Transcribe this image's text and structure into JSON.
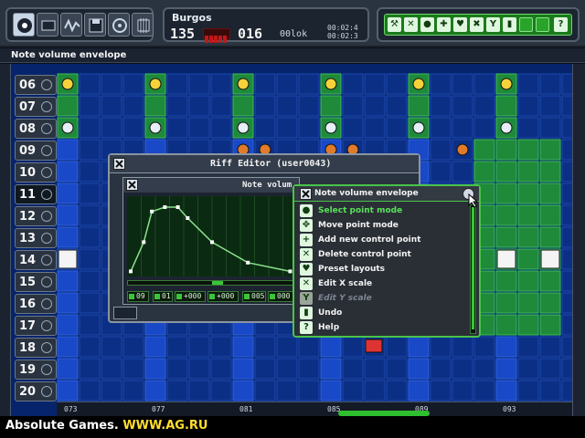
{
  "status_bar": {
    "text": "Note volume envelope"
  },
  "song_info": {
    "name": "Burgos",
    "pattern": "135",
    "row": "016",
    "memory": "00lok",
    "time_line1": "00:02:4",
    "time_line2": "00:02:3"
  },
  "toolbar": {
    "tools": [
      "disk-icon",
      "screen-icon",
      "waveform-icon",
      "floppy-icon",
      "reel-icon",
      "chip-icon"
    ],
    "active_tool": "disk-icon"
  },
  "icon_palette": [
    "wrench-icon",
    "x-icon",
    "dot-icon",
    "cross-icon",
    "heart-icon",
    "x-icon",
    "y-icon",
    "bell-icon",
    "blank",
    "blank",
    "question-icon"
  ],
  "rows": [
    "06",
    "07",
    "08",
    "09",
    "10",
    "11",
    "12",
    "13",
    "14",
    "15",
    "16",
    "17",
    "18",
    "19",
    "20"
  ],
  "current_row": "11",
  "ruler": [
    "073",
    "077",
    "081",
    "085",
    "089",
    "093"
  ],
  "riff_editor": {
    "title": "Riff Editor (user0043)",
    "envelope_title": "Note volum",
    "fields": [
      "09",
      "01",
      "+000",
      "+000",
      "005",
      "000"
    ],
    "envelope_points": [
      [
        0,
        0.02
      ],
      [
        0.08,
        0.42
      ],
      [
        0.13,
        0.84
      ],
      [
        0.21,
        0.9
      ],
      [
        0.29,
        0.9
      ],
      [
        0.35,
        0.75
      ],
      [
        0.5,
        0.42
      ],
      [
        0.72,
        0.14
      ],
      [
        0.98,
        0.02
      ]
    ]
  },
  "context_menu": {
    "title": "Note volume envelope",
    "items": [
      {
        "label": "Select point mode",
        "icon": "dot-icon",
        "state": "selected"
      },
      {
        "label": "Move point mode",
        "icon": "move-icon",
        "state": "normal"
      },
      {
        "label": "Add new control point",
        "icon": "plus-icon",
        "state": "normal"
      },
      {
        "label": "Delete control point",
        "icon": "x-icon",
        "state": "normal"
      },
      {
        "label": "Preset layouts",
        "icon": "heart-icon",
        "state": "normal"
      },
      {
        "label": "Edit X scale",
        "icon": "x-icon",
        "state": "normal"
      },
      {
        "label": "Edit Y scale",
        "icon": "y-icon",
        "state": "disabled"
      },
      {
        "label": "Undo",
        "icon": "bell-icon",
        "state": "normal"
      },
      {
        "label": "Help",
        "icon": "question-icon",
        "state": "normal"
      }
    ]
  },
  "watermark": {
    "text": "Absolute Games.",
    "url": "WWW.AG.RU"
  },
  "colors": {
    "grid_blue": "#06246b",
    "track_green": "#1f8a3a",
    "menu_green": "#49c449",
    "selected_item": "#5ae05a"
  }
}
